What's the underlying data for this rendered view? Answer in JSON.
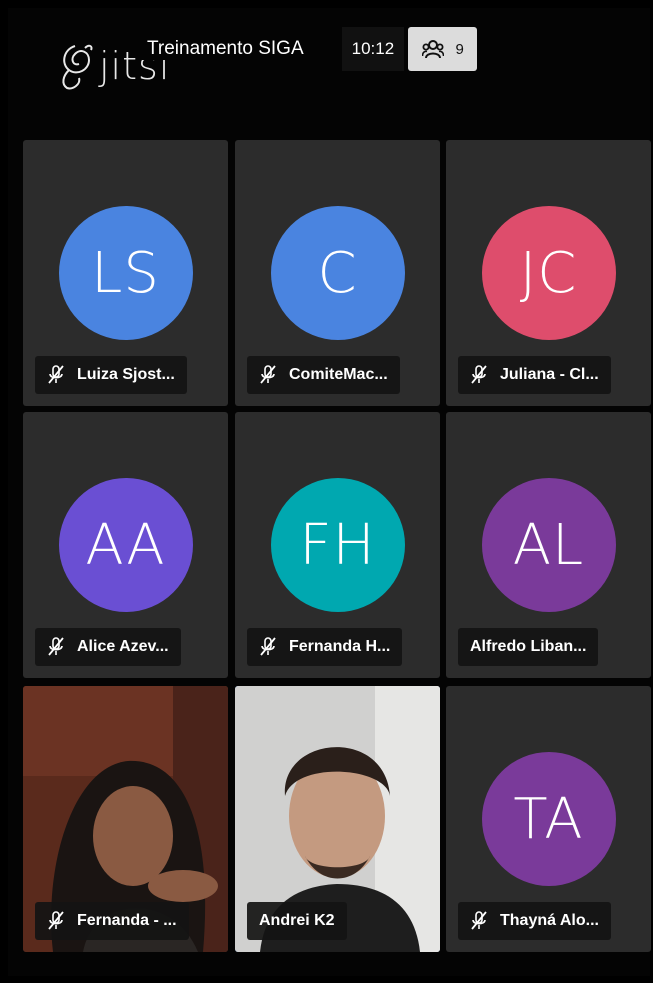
{
  "logo": {
    "text": "jitsi"
  },
  "meeting": {
    "title": "Treinamento SIGA",
    "time": "10:12",
    "participant_count": "9"
  },
  "tiles": [
    {
      "initials": "LS",
      "name": "Luiza Sjost...",
      "muted": true,
      "color": "#4a84e0",
      "video": false
    },
    {
      "initials": "C",
      "name": "ComiteMac...",
      "muted": true,
      "color": "#4a84e0",
      "video": false
    },
    {
      "initials": "JC",
      "name": "Juliana - Cl...",
      "muted": true,
      "color": "#de4d6c",
      "video": false
    },
    {
      "initials": "AA",
      "name": "Alice Azev...",
      "muted": true,
      "color": "#6a4fd3",
      "video": false
    },
    {
      "initials": "FH",
      "name": "Fernanda H...",
      "muted": true,
      "color": "#00a8b0",
      "video": false
    },
    {
      "initials": "AL",
      "name": "Alfredo Liban...",
      "muted": false,
      "color": "#7a3a9a",
      "video": false
    },
    {
      "initials": "",
      "name": "Fernanda - ...",
      "muted": true,
      "color": "",
      "video": true
    },
    {
      "initials": "",
      "name": "Andrei K2",
      "muted": false,
      "color": "",
      "video": true,
      "active": true
    },
    {
      "initials": "TA",
      "name": "Thayná Alo...",
      "muted": true,
      "color": "#7a3a9a",
      "video": false
    }
  ]
}
